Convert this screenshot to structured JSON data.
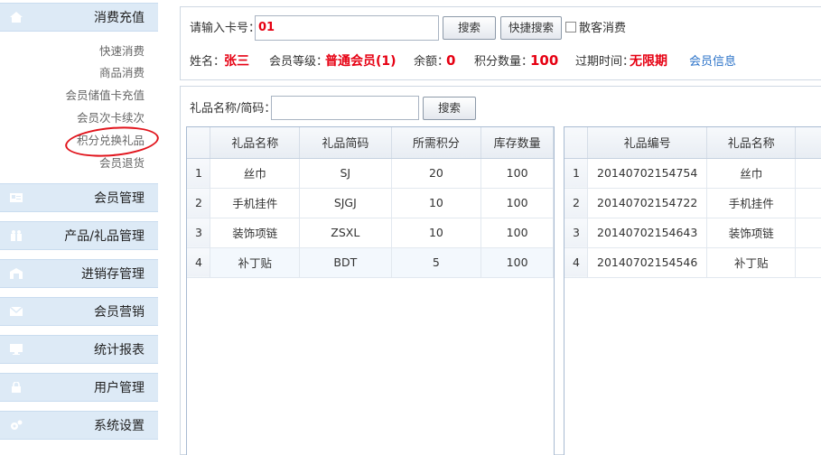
{
  "sidebar": {
    "sections": [
      {
        "label": "消费充值",
        "icon": "home-icon"
      },
      {
        "label": "会员管理",
        "icon": "id-card-icon"
      },
      {
        "label": "产品/礼品管理",
        "icon": "gift-icon"
      },
      {
        "label": "进销存管理",
        "icon": "warehouse-icon"
      },
      {
        "label": "会员营销",
        "icon": "mail-icon"
      },
      {
        "label": "统计报表",
        "icon": "report-icon"
      },
      {
        "label": "用户管理",
        "icon": "lock-icon"
      },
      {
        "label": "系统设置",
        "icon": "gear-icon"
      }
    ],
    "sub_items": [
      "快速消费",
      "商品消费",
      "会员储值卡充值",
      "会员次卡续次",
      "积分兑换礼品",
      "会员退货"
    ],
    "active_sub_item": "积分兑换礼品"
  },
  "member": {
    "card_label": "请输入卡号：",
    "card_value": "01",
    "search_label": "搜索",
    "quick_search_label": "快捷搜索",
    "guest_label": "散客消费",
    "name_label": "姓名：",
    "name_value": "张三",
    "level_label": "会员等级：",
    "level_value": "普通会员(1)",
    "balance_label": "余额：",
    "balance_value": "0",
    "points_label": "积分数量：",
    "points_value": "100",
    "expire_label": "过期时间：",
    "expire_value": "无限期",
    "info_link": "会员信息"
  },
  "gift_search": {
    "label": "礼品名称/简码：",
    "search_label": "搜索"
  },
  "left_table": {
    "headers": [
      "",
      "礼品名称",
      "礼品简码",
      "所需积分",
      "库存数量"
    ],
    "rows": [
      [
        "1",
        "丝巾",
        "SJ",
        "20",
        "100"
      ],
      [
        "2",
        "手机挂件",
        "SJGJ",
        "10",
        "100"
      ],
      [
        "3",
        "装饰项链",
        "ZSXL",
        "10",
        "100"
      ],
      [
        "4",
        "补丁贴",
        "BDT",
        "5",
        "100"
      ]
    ]
  },
  "right_table": {
    "headers": [
      "",
      "礼品编号",
      "礼品名称"
    ],
    "rows": [
      [
        "1",
        "20140702154754",
        "丝巾"
      ],
      [
        "2",
        "20140702154722",
        "手机挂件"
      ],
      [
        "3",
        "20140702154643",
        "装饰项链"
      ],
      [
        "4",
        "20140702154546",
        "补丁贴"
      ]
    ]
  },
  "colors": {
    "accent_red": "#e60012",
    "link_blue": "#2a72c8",
    "sidebar_bg": "#ddeaf6",
    "annotation_circle": "#e1141c"
  }
}
